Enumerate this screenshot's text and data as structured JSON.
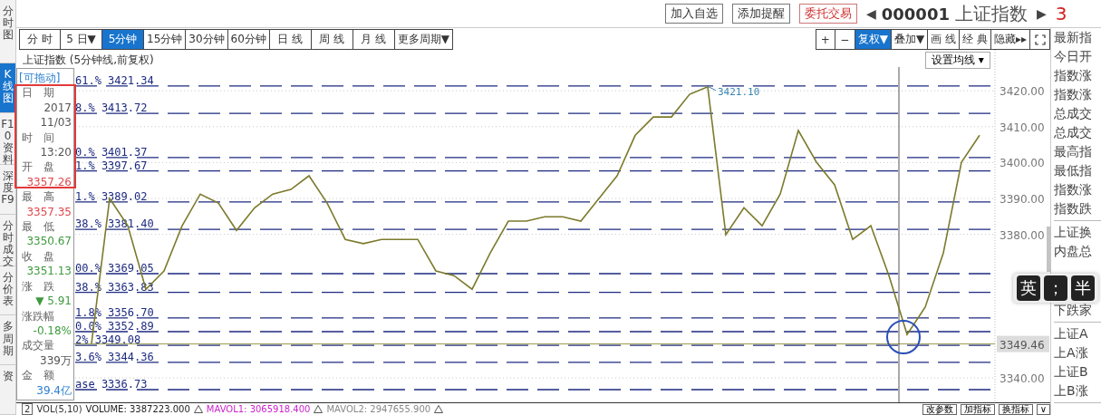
{
  "side_tabs": [
    {
      "label": "分时图",
      "selected": false
    },
    {
      "label": "K线图",
      "selected": true
    },
    {
      "label": "F10资料",
      "selected": false
    },
    {
      "label": "深度F9",
      "selected": false
    },
    {
      "label": "分时成交",
      "selected": false
    },
    {
      "label": "分价表",
      "selected": false
    },
    {
      "label": "多周期",
      "selected": false
    },
    {
      "label": "资",
      "selected": false
    }
  ],
  "header": {
    "buttons": [
      {
        "label": "加入自选",
        "kind": "plain"
      },
      {
        "label": "添加提醒",
        "kind": "plain"
      },
      {
        "label": "委托交易",
        "kind": "trade"
      }
    ],
    "prev": "◀",
    "code": "000001",
    "name": "上证指数",
    "next": "▶",
    "price": "3"
  },
  "periods": [
    {
      "label": "分 时",
      "selected": false
    },
    {
      "label": "5 日▼",
      "selected": false
    },
    {
      "label": "5分钟",
      "selected": true
    },
    {
      "label": "15分钟",
      "selected": false
    },
    {
      "label": "30分钟",
      "selected": false
    },
    {
      "label": "60分钟",
      "selected": false
    },
    {
      "label": "日 线",
      "selected": false
    },
    {
      "label": "周 线",
      "selected": false
    },
    {
      "label": "月 线",
      "selected": false
    },
    {
      "label": "更多周期▼",
      "selected": false
    }
  ],
  "tools": [
    {
      "label": "+",
      "selected": false
    },
    {
      "label": "−",
      "selected": false
    },
    {
      "label": "复权▼",
      "selected": true
    },
    {
      "label": "叠加▼",
      "selected": false
    },
    {
      "label": "画 线",
      "selected": false
    },
    {
      "label": "经 典",
      "selected": false
    },
    {
      "label": "隐藏▸▸",
      "selected": false
    }
  ],
  "chart": {
    "title": "上证指数 (5分钟线,前复权)",
    "ma_button": "设置均线 ▾",
    "chart_data": {
      "type": "line",
      "grid": true,
      "series": [
        {
          "color": "#7c7a2c",
          "values": [
            3349.6,
            3390.0,
            3382.4,
            3364.7,
            3369.8,
            3382.4,
            3391.2,
            3388.7,
            3381.1,
            3387.4,
            3391.2,
            3392.5,
            3396.3,
            3388.7,
            3378.6,
            3377.4,
            3378.6,
            3378.6,
            3378.6,
            3369.8,
            3368.5,
            3364.7,
            3374.8,
            3383.7,
            3383.7,
            3384.9,
            3384.9,
            3383.7,
            3390.0,
            3396.3,
            3407.6,
            3412.7,
            3412.7,
            3419.0,
            3421.1,
            3379.9,
            3387.4,
            3382.4,
            3391.2,
            3408.9,
            3400.1,
            3393.8,
            3378.6,
            3382.4,
            3368.5,
            3352.1,
            3359.7,
            3374.8,
            3400.1,
            3407.6
          ]
        }
      ],
      "ylim": [
        3333.2,
        3431.4
      ],
      "yticks": [
        {
          "value": 3340,
          "label": "3340.00"
        },
        {
          "value": 3380,
          "label": "3380.00"
        },
        {
          "value": 3390,
          "label": "3390.00"
        },
        {
          "value": 3400,
          "label": "3400.00"
        },
        {
          "value": 3410,
          "label": "3410.00"
        },
        {
          "value": 3420,
          "label": "3420.00"
        }
      ],
      "ref_lines": [
        {
          "axis": "y",
          "value": 3421.34,
          "label": "61.% 3421.34"
        },
        {
          "axis": "y",
          "value": 3413.72,
          "label": "8.% 3413.72"
        },
        {
          "axis": "y",
          "value": 3401.37,
          "label": "0.% 3401.37"
        },
        {
          "axis": "y",
          "value": 3397.67,
          "label": "1.% 3397.67"
        },
        {
          "axis": "y",
          "value": 3389.02,
          "label": "1.% 3389.02"
        },
        {
          "axis": "y",
          "value": 3381.4,
          "label": "38.% 3381.40"
        },
        {
          "axis": "y",
          "value": 3369.05,
          "label": "00.% 3369.05"
        },
        {
          "axis": "y",
          "value": 3363.83,
          "label": "38.% 3363.83"
        },
        {
          "axis": "y",
          "value": 3356.7,
          "label": "1.8% 3356.70"
        },
        {
          "axis": "y",
          "value": 3352.89,
          "label": "0.0% 3352.89"
        },
        {
          "axis": "y",
          "value": 3349.08,
          "label": "2% 3349.08"
        },
        {
          "axis": "y",
          "value": 3344.36,
          "label": "3.6% 3344.36"
        },
        {
          "axis": "y",
          "value": 3336.73,
          "label": "ase 3336.73"
        },
        {
          "axis": "y",
          "value": 3349.46,
          "label": "3349.46",
          "color": "#9a9a50"
        }
      ],
      "annotations": [
        "3421.10"
      ]
    }
  },
  "info": {
    "hint": "[可拖动]",
    "rows": [
      {
        "label": "日　期",
        "values": [
          "2017",
          "11/03"
        ],
        "color": "#555555"
      },
      {
        "label": "时　间",
        "values": [
          "13:20"
        ],
        "color": "#555555"
      },
      {
        "label": "开　盘",
        "values": [
          "3357.26"
        ],
        "color": "#e0474c"
      },
      {
        "label": "最　高",
        "values": [
          "3357.35"
        ],
        "color": "#e0474c"
      },
      {
        "label": "最　低",
        "values": [
          "3350.67"
        ],
        "color": "#3e9a3e"
      },
      {
        "label": "收　盘",
        "values": [
          "3351.13"
        ],
        "color": "#3e9a3e"
      },
      {
        "label": "涨　跌",
        "values": [
          "▼ 5.91"
        ],
        "color": "#3e9a3e"
      },
      {
        "label": "涨跌幅",
        "values": [
          "-0.18%"
        ],
        "color": "#3e9a3e"
      },
      {
        "label": "成交量",
        "values": [
          "339万"
        ],
        "color": "#555555"
      },
      {
        "label": "金　额",
        "values": [
          "39.4亿"
        ],
        "color": "#2a7fd0"
      }
    ]
  },
  "quote_panel": [
    [
      "最新指",
      "今日开",
      "指数涨",
      "指数涨",
      "总成交",
      "总成交",
      "最高指",
      "最低指",
      "指数涨",
      "指数跌"
    ],
    [
      "上证换",
      "内盘总",
      "下跌家"
    ],
    [
      "上证A",
      "上A涨",
      "上证B",
      "上B涨"
    ]
  ],
  "ime": [
    "英",
    "；",
    "半"
  ],
  "indicator": {
    "index": "2",
    "name": "VOL(5,10)",
    "items": [
      {
        "text": "VOLUME: 3387223.000",
        "color": "#222222"
      },
      {
        "text": "MAVOL1: 3065918.400",
        "color": "#cc22cc"
      },
      {
        "text": "MAVOL2: 2947655.900",
        "color": "#888888"
      }
    ],
    "buttons": [
      "改参数",
      "加指标",
      "换指标",
      "∨"
    ]
  }
}
